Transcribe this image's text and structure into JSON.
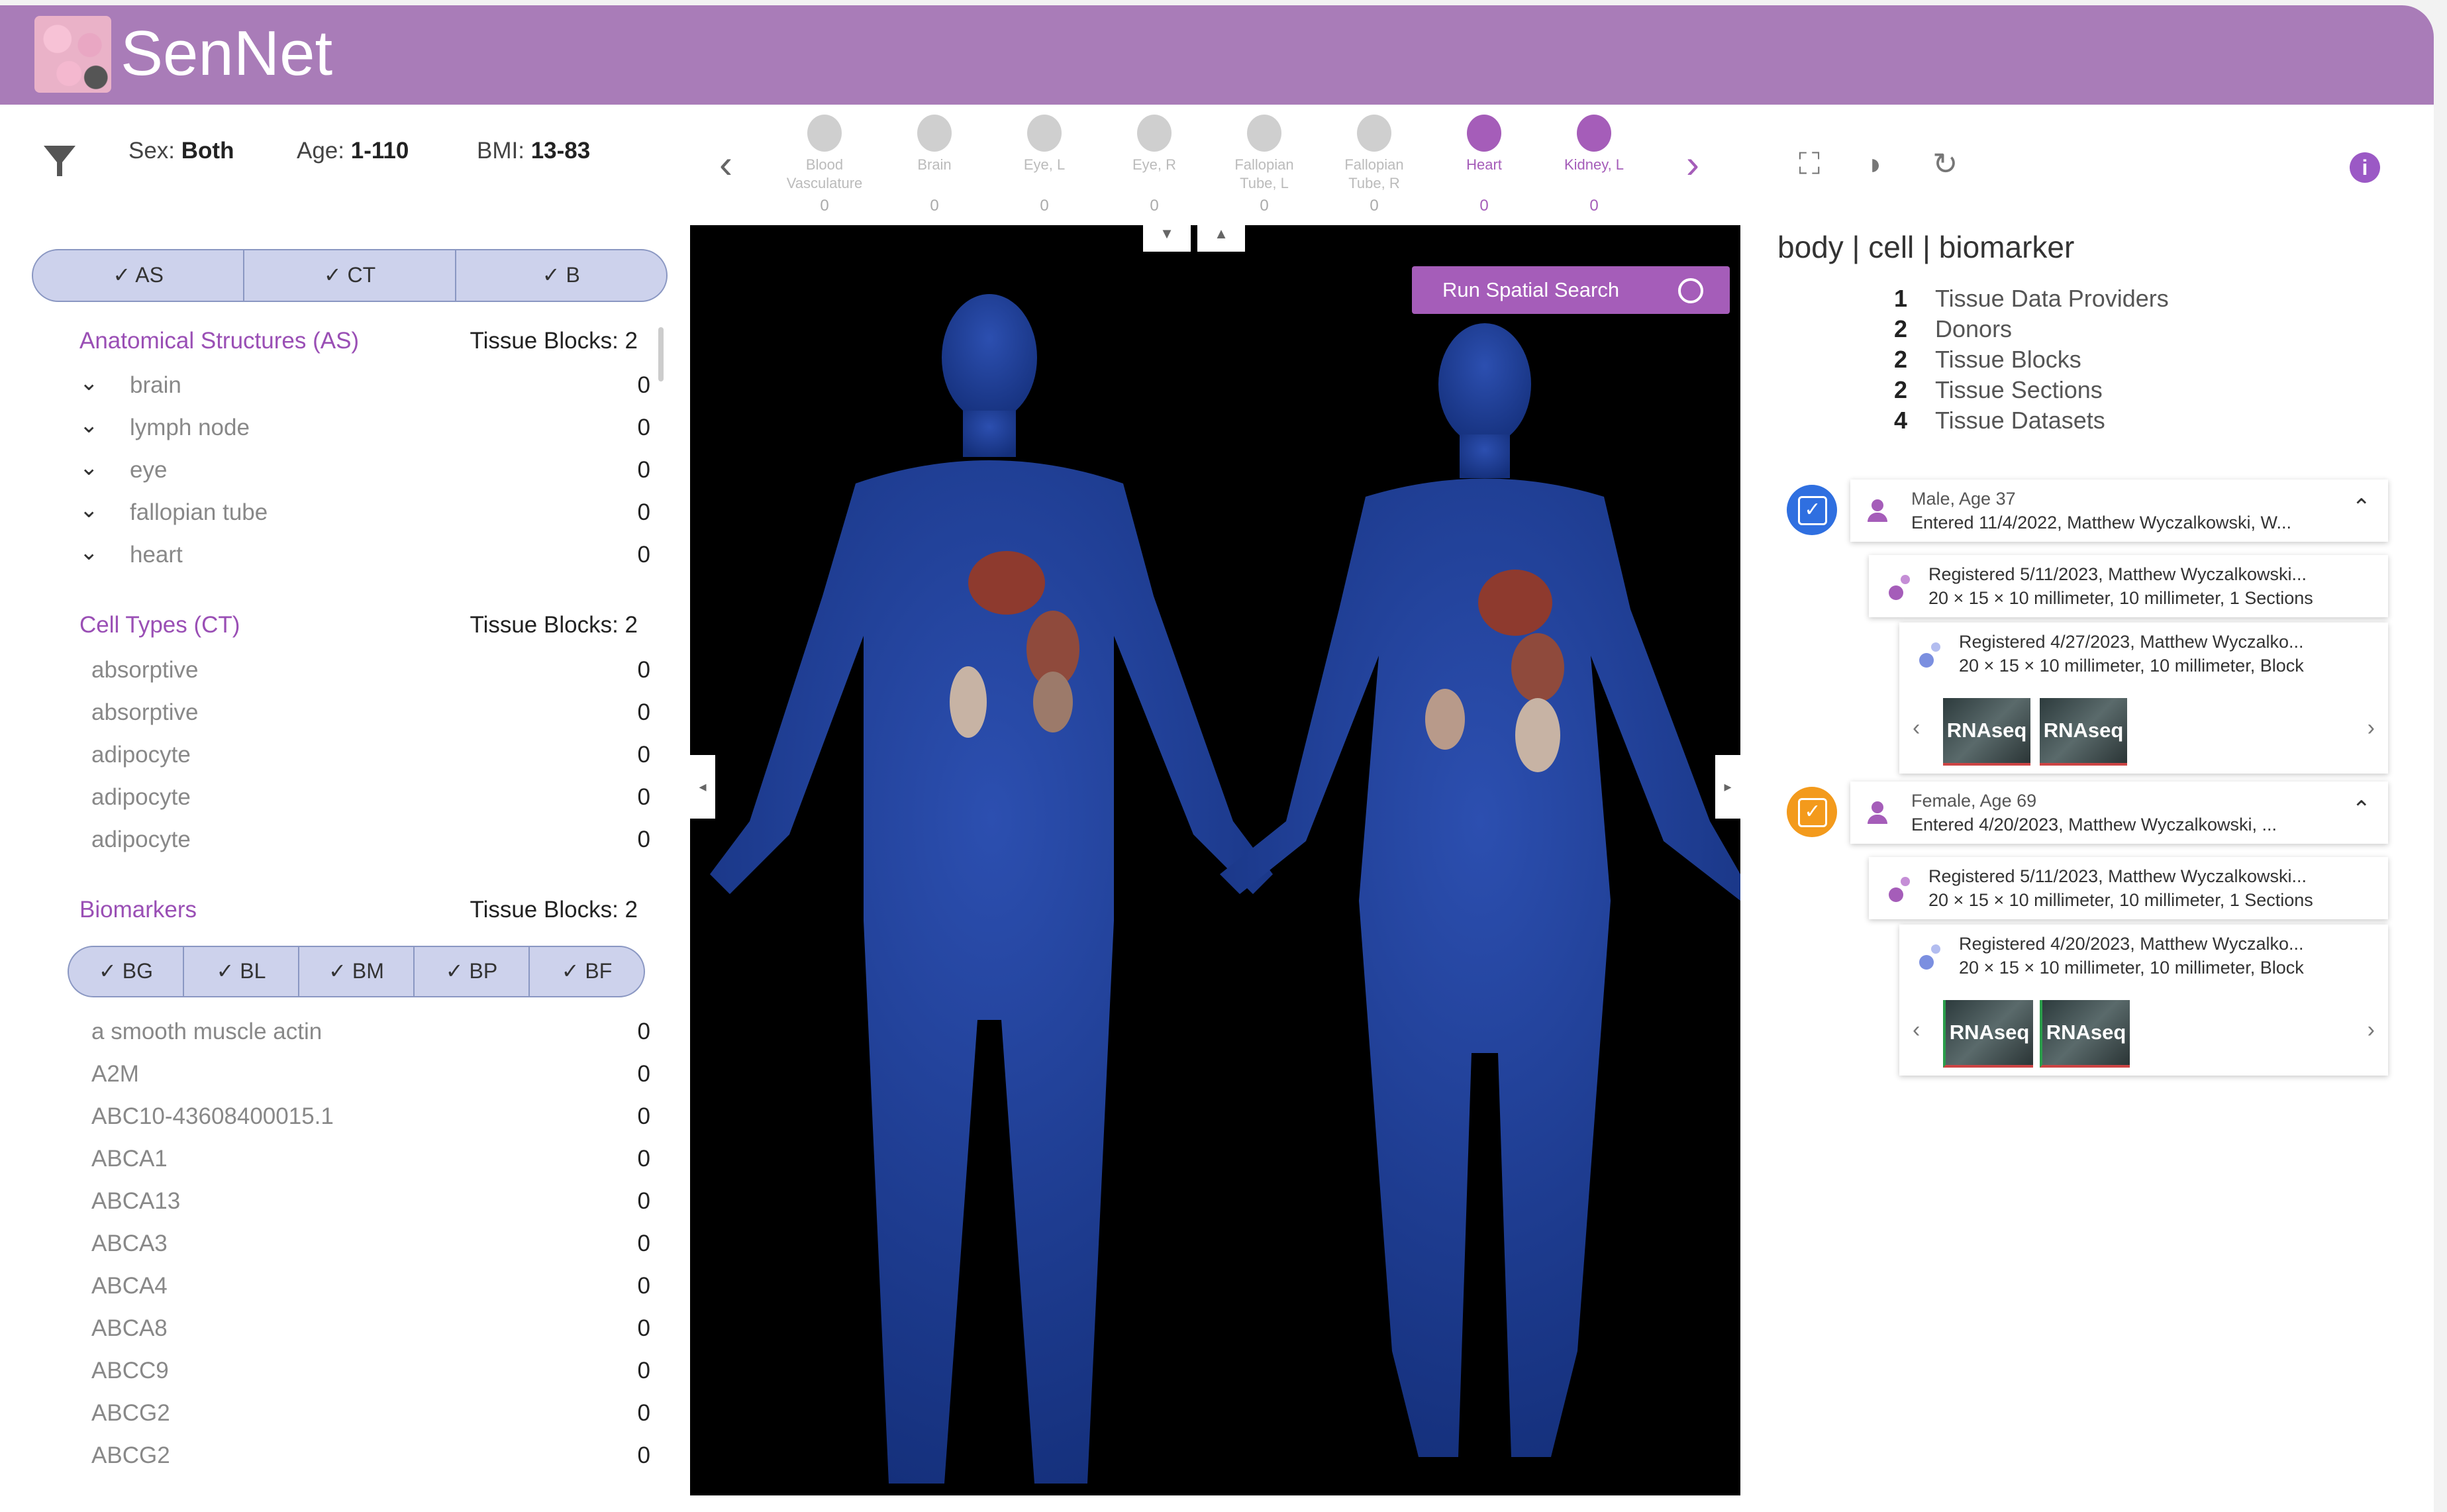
{
  "header": {
    "brand": "SenNet"
  },
  "filters": {
    "sex_label": "Sex:",
    "sex_value": "Both",
    "age_label": "Age:",
    "age_value": "1-110",
    "bmi_label": "BMI:",
    "bmi_value": "13-83"
  },
  "organs": [
    {
      "name": "Blood Vasculature",
      "count": "0",
      "active": false
    },
    {
      "name": "Brain",
      "count": "0",
      "active": false
    },
    {
      "name": "Eye, L",
      "count": "0",
      "active": false
    },
    {
      "name": "Eye, R",
      "count": "0",
      "active": false
    },
    {
      "name": "Fallopian Tube, L",
      "count": "0",
      "active": false
    },
    {
      "name": "Fallopian Tube, R",
      "count": "0",
      "active": false
    },
    {
      "name": "Heart",
      "count": "0",
      "active": true
    },
    {
      "name": "Kidney, L",
      "count": "0",
      "active": true
    }
  ],
  "ontology_toggle": [
    "AS",
    "CT",
    "B"
  ],
  "anatomical": {
    "title": "Anatomical Structures (AS)",
    "count_label": "Tissue Blocks: 2",
    "rows": [
      {
        "label": "brain",
        "value": "0"
      },
      {
        "label": "lymph node",
        "value": "0"
      },
      {
        "label": "eye",
        "value": "0"
      },
      {
        "label": "fallopian tube",
        "value": "0"
      },
      {
        "label": "heart",
        "value": "0"
      }
    ]
  },
  "cell_types": {
    "title": "Cell Types (CT)",
    "count_label": "Tissue Blocks: 2",
    "rows": [
      {
        "label": "absorptive",
        "value": "0"
      },
      {
        "label": "absorptive",
        "value": "0"
      },
      {
        "label": "adipocyte",
        "value": "0"
      },
      {
        "label": "adipocyte",
        "value": "0"
      },
      {
        "label": "adipocyte",
        "value": "0"
      }
    ]
  },
  "biomarkers": {
    "title": "Biomarkers",
    "count_label": "Tissue Blocks: 2",
    "toggle": [
      "BG",
      "BL",
      "BM",
      "BP",
      "BF"
    ],
    "rows": [
      {
        "label": "a smooth muscle actin",
        "value": "0"
      },
      {
        "label": "A2M",
        "value": "0"
      },
      {
        "label": "ABC10-43608400015.1",
        "value": "0"
      },
      {
        "label": "ABCA1",
        "value": "0"
      },
      {
        "label": "ABCA13",
        "value": "0"
      },
      {
        "label": "ABCA3",
        "value": "0"
      },
      {
        "label": "ABCA4",
        "value": "0"
      },
      {
        "label": "ABCA8",
        "value": "0"
      },
      {
        "label": "ABCC9",
        "value": "0"
      },
      {
        "label": "ABCG2",
        "value": "0"
      },
      {
        "label": "ABCG2",
        "value": "0"
      }
    ]
  },
  "viewer": {
    "spatial_search_label": "Run Spatial Search"
  },
  "right_panel": {
    "title": "body | cell | biomarker",
    "stats": [
      {
        "count": "1",
        "label": "Tissue Data Providers"
      },
      {
        "count": "2",
        "label": "Donors"
      },
      {
        "count": "2",
        "label": "Tissue Blocks"
      },
      {
        "count": "2",
        "label": "Tissue Sections"
      },
      {
        "count": "4",
        "label": "Tissue Datasets"
      }
    ],
    "donors": [
      {
        "title": "Male, Age 37",
        "entered": "Entered 11/4/2022, Matthew Wyczalkowski, W...",
        "check_color": "#2f6fe0",
        "block": {
          "line1": "Registered 5/11/2023, Matthew Wyczalkowski...",
          "line2": "20 × 15 × 10 millimeter, 10 millimeter, 1 Sections"
        },
        "section": {
          "line1": "Registered 4/27/2023, Matthew Wyczalko...",
          "line2": "20 × 15 × 10 millimeter, 10 millimeter, Block"
        },
        "datasets": [
          "RNAseq",
          "RNAseq"
        ]
      },
      {
        "title": "Female, Age 69",
        "entered": "Entered 4/20/2023, Matthew Wyczalkowski, ...",
        "check_color": "#f39a1c",
        "block": {
          "line1": "Registered 5/11/2023, Matthew Wyczalkowski...",
          "line2": "20 × 15 × 10 millimeter, 10 millimeter, 1 Sections"
        },
        "section": {
          "line1": "Registered 4/20/2023, Matthew Wyczalko...",
          "line2": "20 × 15 × 10 millimeter, 10 millimeter, Block"
        },
        "datasets": [
          "RNAseq",
          "RNAseq"
        ]
      }
    ]
  },
  "colors": {
    "brand": "#a97cb8",
    "accent": "#a55db9",
    "toggle_bg": "#cdd2ec",
    "body_blue": "#1c3a8a"
  }
}
